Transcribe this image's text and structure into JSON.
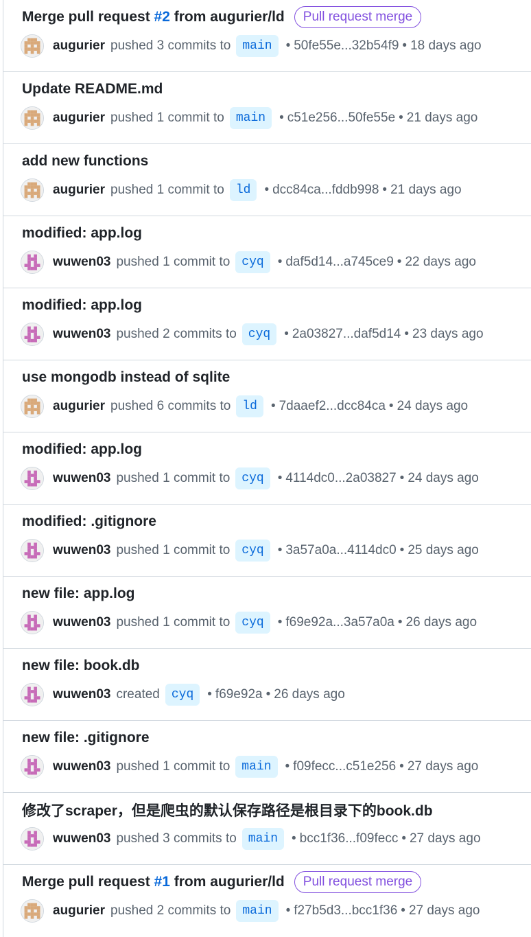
{
  "colors": {
    "link": "#0969da",
    "pill_purple": "#8250df",
    "branch_bg": "#ddf4ff",
    "muted_text": "#59636e",
    "avatar_augurier": "#d9a97a",
    "avatar_wuwen03": "#c76bb8"
  },
  "icons": {
    "augurier_avatar": "identicon-tan",
    "wuwen03_avatar": "identicon-pink"
  },
  "separator": "•",
  "events": [
    {
      "title_prefix": "Merge pull request ",
      "pr_number": "#2",
      "title_suffix": " from augurier/ld",
      "label": "Pull request merge",
      "actor": "augurier",
      "verb": "pushed 3 commits to",
      "branch": "main",
      "commits": "50fe55e...32b54f9",
      "time": "18 days ago"
    },
    {
      "title": "Update README.md",
      "actor": "augurier",
      "verb": "pushed 1 commit to",
      "branch": "main",
      "commits": "c51e256...50fe55e",
      "time": "21 days ago"
    },
    {
      "title": "add new functions",
      "actor": "augurier",
      "verb": "pushed 1 commit to",
      "branch": "ld",
      "commits": "dcc84ca...fddb998",
      "time": "21 days ago"
    },
    {
      "title": "modified: app.log",
      "actor": "wuwen03",
      "verb": "pushed 1 commit to",
      "branch": "cyq",
      "commits": "daf5d14...a745ce9",
      "time": "22 days ago"
    },
    {
      "title": "modified: app.log",
      "actor": "wuwen03",
      "verb": "pushed 2 commits to",
      "branch": "cyq",
      "commits": "2a03827...daf5d14",
      "time": "23 days ago"
    },
    {
      "title": "use mongodb instead of sqlite",
      "actor": "augurier",
      "verb": "pushed 6 commits to",
      "branch": "ld",
      "commits": "7daaef2...dcc84ca",
      "time": "24 days ago"
    },
    {
      "title": "modified: app.log",
      "actor": "wuwen03",
      "verb": "pushed 1 commit to",
      "branch": "cyq",
      "commits": "4114dc0...2a03827",
      "time": "24 days ago"
    },
    {
      "title": "modified: .gitignore",
      "actor": "wuwen03",
      "verb": "pushed 1 commit to",
      "branch": "cyq",
      "commits": "3a57a0a...4114dc0",
      "time": "25 days ago"
    },
    {
      "title": "new file: app.log",
      "actor": "wuwen03",
      "verb": "pushed 1 commit to",
      "branch": "cyq",
      "commits": "f69e92a...3a57a0a",
      "time": "26 days ago"
    },
    {
      "title": "new file: book.db",
      "actor": "wuwen03",
      "verb": "created",
      "branch": "cyq",
      "commits": "f69e92a",
      "time": "26 days ago"
    },
    {
      "title": "new file: .gitignore",
      "actor": "wuwen03",
      "verb": "pushed 1 commit to",
      "branch": "main",
      "commits": "f09fecc...c51e256",
      "time": "27 days ago"
    },
    {
      "title": "修改了scraper，但是爬虫的默认保存路径是根目录下的book.db",
      "actor": "wuwen03",
      "verb": "pushed 3 commits to",
      "branch": "main",
      "commits": "bcc1f36...f09fecc",
      "time": "27 days ago"
    },
    {
      "title_prefix": "Merge pull request ",
      "pr_number": "#1",
      "title_suffix": " from augurier/ld",
      "label": "Pull request merge",
      "actor": "augurier",
      "verb": "pushed 2 commits to",
      "branch": "main",
      "commits": "f27b5d3...bcc1f36",
      "time": "27 days ago"
    }
  ]
}
